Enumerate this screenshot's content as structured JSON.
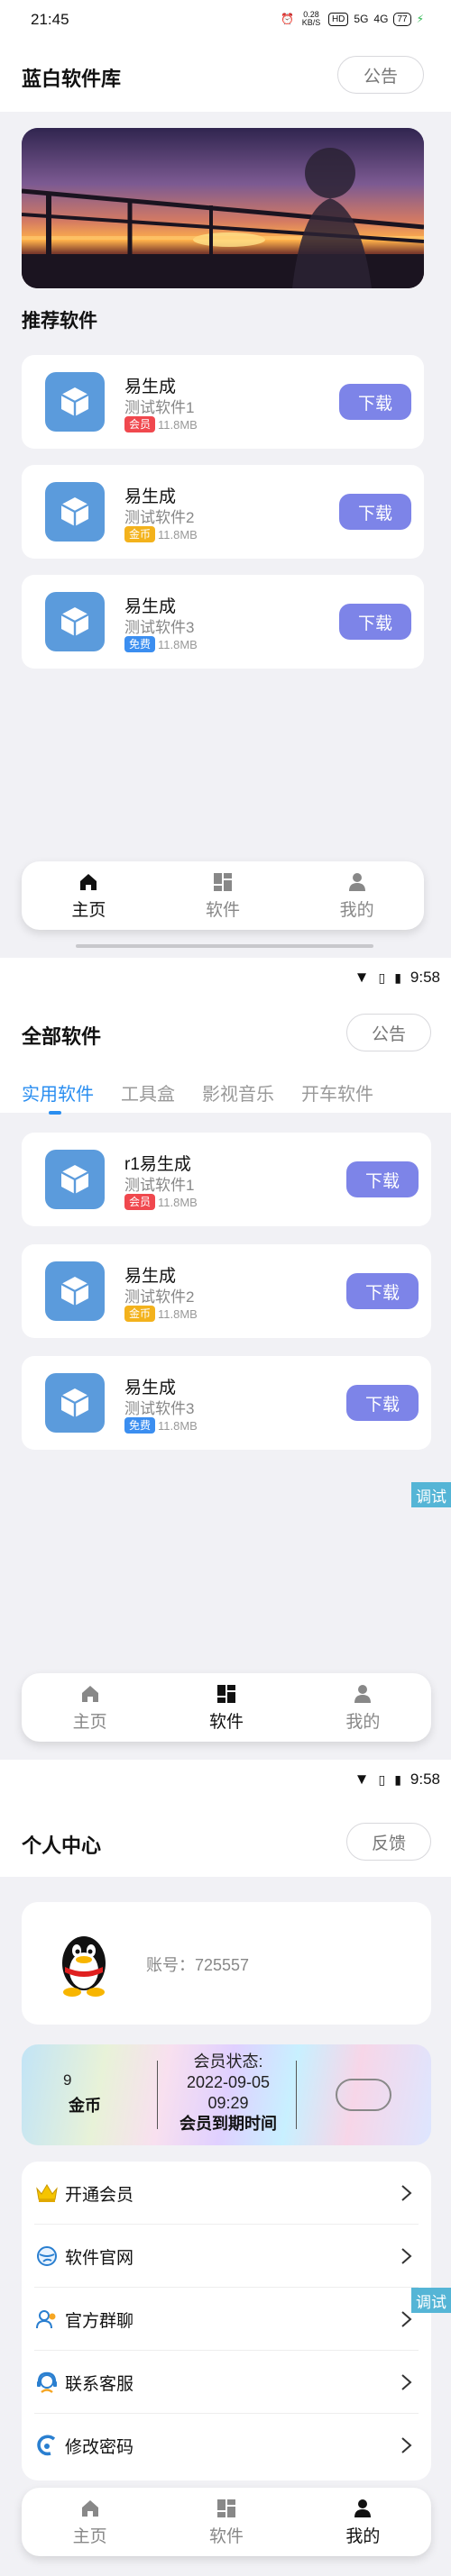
{
  "screen1": {
    "status_time": "21:45",
    "status_icons": {
      "speed": "0.28 KB/S",
      "hd": "HD",
      "signal1": "5G",
      "signal2": "4G",
      "battery": "77"
    },
    "title": "蓝白软件库",
    "notice_button": "公告",
    "section_title": "推荐软件",
    "apps": [
      {
        "name": "易生成",
        "desc": "测试软件1",
        "tag": "会员",
        "tag_color": "#f0484e",
        "size": "11.8MB",
        "button": "下载"
      },
      {
        "name": "易生成",
        "desc": "测试软件2",
        "tag": "金币",
        "tag_color": "#f3b21c",
        "size": "11.8MB",
        "button": "下载"
      },
      {
        "name": "易生成",
        "desc": "测试软件3",
        "tag": "免费",
        "tag_color": "#3b8ef0",
        "size": "11.8MB",
        "button": "下载"
      }
    ],
    "nav": [
      {
        "label": "主页",
        "icon": "home-icon"
      },
      {
        "label": "软件",
        "icon": "grid-icon"
      },
      {
        "label": "我的",
        "icon": "user-icon"
      }
    ],
    "active_nav": 0
  },
  "screen2": {
    "status_time": "9:58",
    "title": "全部软件",
    "notice_button": "公告",
    "tabs": [
      "实用软件",
      "工具盒",
      "影视音乐",
      "开车软件"
    ],
    "active_tab": 0,
    "apps": [
      {
        "name": "r1易生成",
        "desc": "测试软件1",
        "tag": "会员",
        "tag_color": "#f0484e",
        "size": "11.8MB",
        "button": "下载"
      },
      {
        "name": "易生成",
        "desc": "测试软件2",
        "tag": "金币",
        "tag_color": "#f3b21c",
        "size": "11.8MB",
        "button": "下载"
      },
      {
        "name": "易生成",
        "desc": "测试软件3",
        "tag": "免费",
        "tag_color": "#3b8ef0",
        "size": "11.8MB",
        "button": "下载"
      }
    ],
    "debug": "调试",
    "nav": [
      {
        "label": "主页",
        "icon": "home-icon"
      },
      {
        "label": "软件",
        "icon": "grid-icon"
      },
      {
        "label": "我的",
        "icon": "user-icon"
      }
    ],
    "active_nav": 1
  },
  "screen3": {
    "status_time": "9:58",
    "title": "个人中心",
    "feedback_button": "反馈",
    "account": "账号：725557",
    "coins_value": "9",
    "coins_label": "金币",
    "member_status_label": "会员状态:",
    "member_expiry": "2022-09-05 09:29",
    "member_expiry_label": "会员到期时间",
    "menu": [
      {
        "label": "开通会员",
        "icon": "crown-icon"
      },
      {
        "label": "软件官网",
        "icon": "globe-icon"
      },
      {
        "label": "官方群聊",
        "icon": "group-chat-icon"
      },
      {
        "label": "联系客服",
        "icon": "headset-icon"
      },
      {
        "label": "修改密码",
        "icon": "key-icon"
      }
    ],
    "debug": "调试",
    "nav": [
      {
        "label": "主页",
        "icon": "home-icon"
      },
      {
        "label": "软件",
        "icon": "grid-icon"
      },
      {
        "label": "我的",
        "icon": "user-icon"
      }
    ],
    "active_nav": 2
  }
}
